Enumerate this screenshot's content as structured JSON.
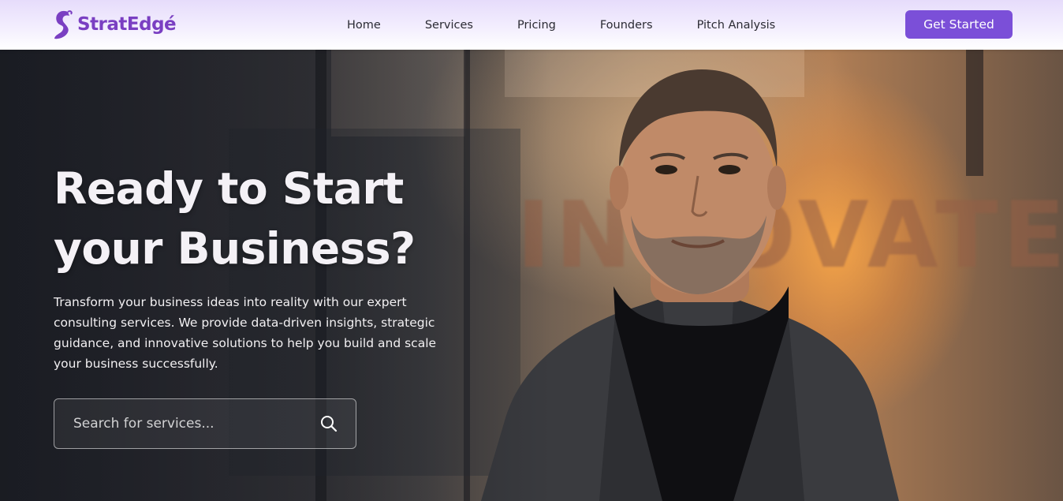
{
  "brand": {
    "name": "StratEdgé",
    "logo_icon": "swan-logo-icon",
    "color": "#7a3fc2"
  },
  "nav": {
    "links": [
      "Home",
      "Services",
      "Pricing",
      "Founders",
      "Pitch Analysis"
    ],
    "cta_label": "Get Started",
    "cta_color": "#7b4fd8"
  },
  "hero": {
    "title_line1": "Ready to Start",
    "title_line2": "your Business?",
    "description": "Transform your business ideas into reality with our expert consulting services. We provide data-driven insights, strategic guidance, and innovative solutions to help you build and scale your business successfully.",
    "background_sign_text": "INNOVATE",
    "search": {
      "placeholder": "Search for services...",
      "value": "",
      "icon": "search-icon"
    }
  }
}
